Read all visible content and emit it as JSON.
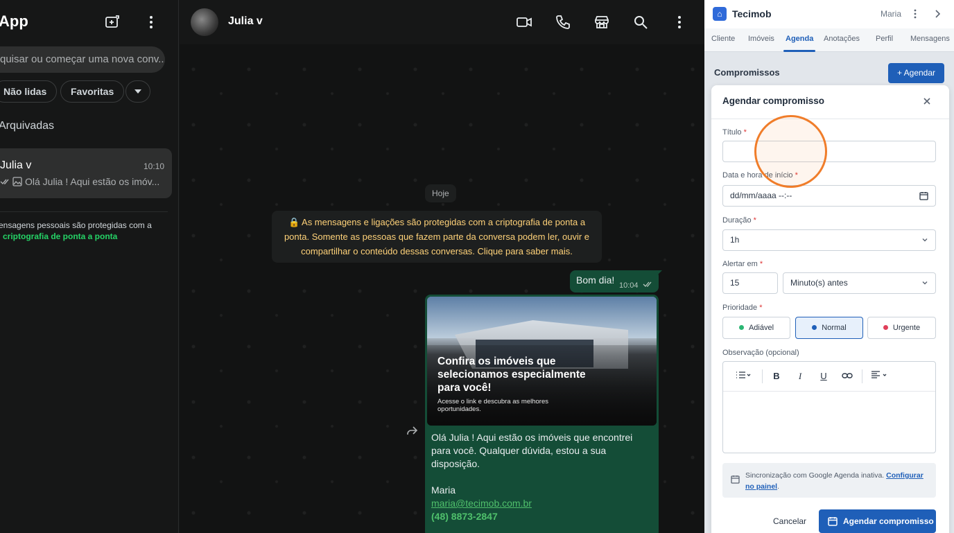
{
  "left": {
    "title": "App",
    "search_placeholder": "quisar ou começar uma nova conv...",
    "filters": [
      "Não lidas",
      "Favoritas"
    ],
    "archived": "Arquivadas",
    "chat": {
      "name": "Julia v",
      "time": "10:10",
      "preview": "Olá Julia ! Aqui estão os imóv..."
    },
    "encryption_text": "ensagens pessoais são protegidas com a",
    "encryption_link": "criptografia de ponta a ponta"
  },
  "conversation": {
    "contact_name": "Julia v",
    "day_label": "Hoje",
    "system_notice": "🔒 As mensagens e ligações são protegidas com a criptografia de ponta a ponta. Somente as pessoas que fazem parte da conversa podem ler, ouvir e compartilhar o conteúdo dessas conversas. Clique para saber mais.",
    "message1": {
      "text": "Bom dia!",
      "time": "10:04"
    },
    "promo": {
      "headline": "Confira os imóveis que selecionamos especialmente para você!",
      "subline": "Acesse o link e descubra as melhores oportunidades."
    },
    "message2": {
      "text": "Olá Julia ! Aqui estão os imóveis que encontrei para você. Qualquer dúvida, estou a sua disposição.",
      "signature": "Maria",
      "email": "maria@tecimob.com.br",
      "phone": "(48) 8873-2847"
    }
  },
  "panel": {
    "brand": "Tecimob",
    "user": "Maria",
    "tabs": [
      "Cliente",
      "Imóveis",
      "Agenda",
      "Anotações",
      "Perfil",
      "Mensagens"
    ],
    "active_tab": "Agenda",
    "section_title": "Compromissos",
    "add_button": "+ Agendar",
    "modal": {
      "title": "Agendar compromisso",
      "titulo_label": "Título",
      "titulo_value": "",
      "datetime_label": "Data e hora de início",
      "datetime_placeholder": "dd/mm/aaaa --:--",
      "duration_label": "Duração",
      "duration_value": "1h",
      "alert_label": "Alertar em",
      "alert_value": "15",
      "alert_unit": "Minuto(s) antes",
      "priority_label": "Prioridade",
      "priorities": [
        {
          "label": "Adiável",
          "color": "#2bb673"
        },
        {
          "label": "Normal",
          "color": "#1f5fb8"
        },
        {
          "label": "Urgente",
          "color": "#e0405a"
        }
      ],
      "selected_priority": "Normal",
      "notes_label": "Observação (opcional)",
      "sync_text": "Sincronização com Google Agenda inativa.",
      "sync_link": "Configurar no painel",
      "cancel": "Cancelar",
      "submit": "Agendar compromisso"
    }
  },
  "colors": {
    "whatsapp_bg": "#121313",
    "outgoing_bubble": "#144d37",
    "accent_green": "#25d366",
    "panel_blue": "#1f5fb8",
    "highlight_ring": "#f07d2a"
  }
}
